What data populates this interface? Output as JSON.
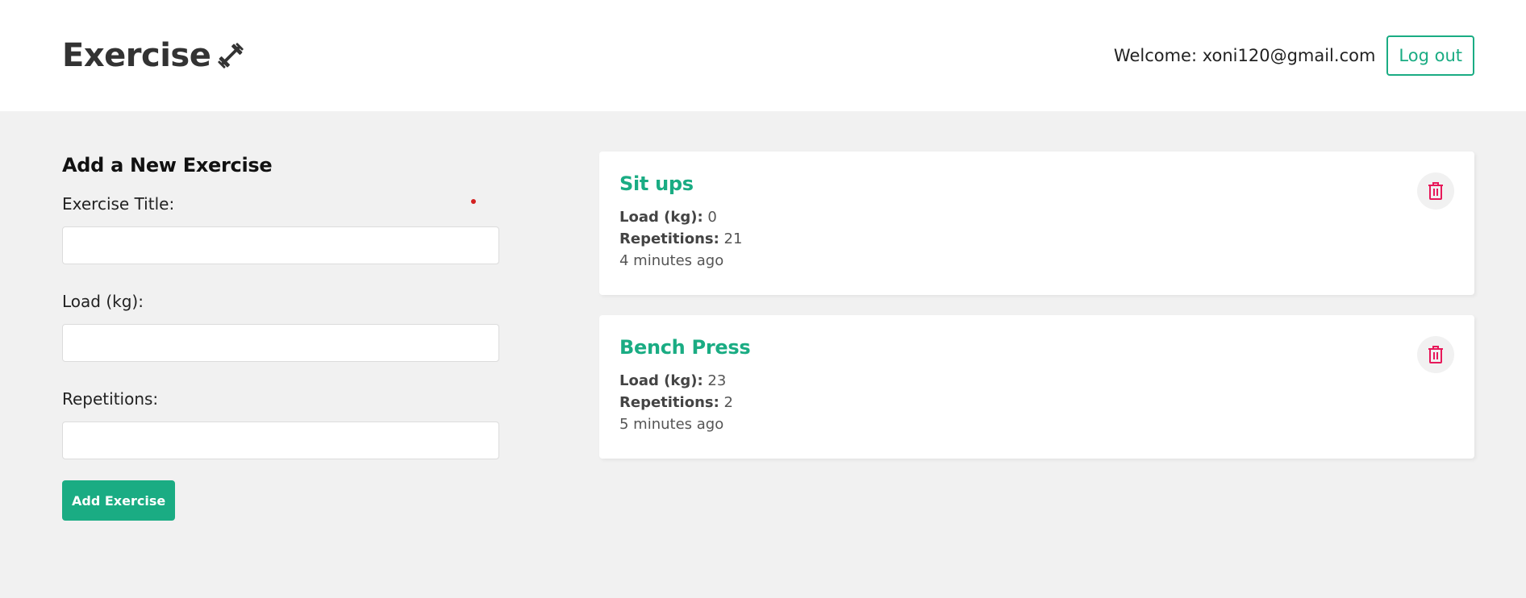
{
  "header": {
    "brand": "Exercise",
    "brand_icon": "dumbbell-icon",
    "welcome": "Welcome: xoni120@gmail.com",
    "logout_label": "Log out"
  },
  "form": {
    "heading": "Add a New Exercise",
    "title_label": "Exercise Title:",
    "load_label": "Load (kg):",
    "reps_label": "Repetitions:",
    "title_value": "",
    "load_value": "",
    "reps_value": "",
    "submit_label": "Add Exercise"
  },
  "exercises": [
    {
      "title": "Sit ups",
      "load_label": "Load (kg):",
      "load": "0",
      "reps_label": "Repetitions:",
      "reps": "21",
      "time": "4 minutes ago"
    },
    {
      "title": "Bench Press",
      "load_label": "Load (kg):",
      "load": "23",
      "reps_label": "Repetitions:",
      "reps": "2",
      "time": "5 minutes ago"
    }
  ],
  "colors": {
    "accent": "#1aac83",
    "danger": "#e7195a",
    "background": "#f1f1f1"
  }
}
